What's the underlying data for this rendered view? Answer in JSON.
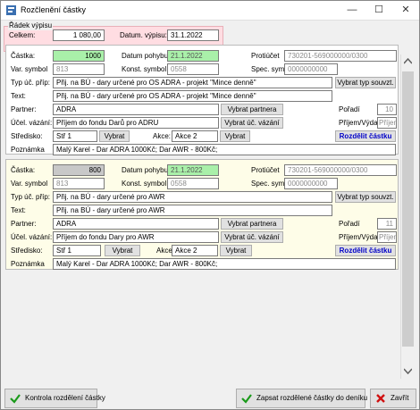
{
  "window": {
    "title": "Rozčlenění částky",
    "minimize": "—",
    "maximize": "☐",
    "close": "✕"
  },
  "statement": {
    "group_label": "Řádek výpisu",
    "total_label": "Celkem:",
    "total_value": "1 080,00",
    "date_label": "Datum. výpisu:",
    "date_value": "31.1.2022"
  },
  "labels": {
    "castka": "Částka:",
    "datum_pohybu": "Datum pohybu:",
    "protiucet": "Protiúčet",
    "var_symbol": "Var. symbol",
    "konst_symbol": "Konst. symbol",
    "spec_sym": "Spec. sym:",
    "typ_uc_prip": "Typ úč. příp:",
    "text": "Text:",
    "partner": "Partner:",
    "ucet_vazani": "Účel. vázání:",
    "poradi": "Pořadí",
    "prijem_vydaj": "Příjem/Výdaj",
    "stredisko": "Středisko:",
    "akce": "Akce:",
    "poznamka": "Poznámka"
  },
  "buttons": {
    "vybrat_typ": "Vybrat typ souvzt.",
    "vybrat_partnera": "Vybrat partnera",
    "vybrat_uc": "Vybrat úč. vázání",
    "vybrat": "Vybrat",
    "rozdelit": "Rozdělit částku"
  },
  "split1": {
    "castka": "1000",
    "datum": "21.1.2022",
    "protiucet": "730201-569000000/0300",
    "var_symbol": "813",
    "konst_symbol": "0558",
    "spec_sym": "0000000000",
    "typ": "Přij. na BÚ - dary určené pro OS ADRA - projekt \"Mince denně\"",
    "text": "Přij. na BÚ - dary určené pro OS ADRA - projekt \"Mince denně\"",
    "partner": "ADRA",
    "ucet": "Příjem do fondu Darů pro ADRU",
    "poradi": "10",
    "prijem": "Příjem",
    "stredisko": "Stř 1",
    "akce": "Akce 2",
    "poznamka": "Malý Karel - Dar ADRA 1000Kč; Dar AWR - 800Kč;"
  },
  "split2": {
    "castka": "800",
    "datum": "21.1.2022",
    "protiucet": "730201-569000000/0300",
    "var_symbol": "813",
    "konst_symbol": "0558",
    "spec_sym": "0000000000",
    "typ": "Přij. na BÚ - dary určené pro AWR",
    "text": "Přij. na BÚ - dary určené pro AWR",
    "partner": "ADRA",
    "ucet": "Příjem do fondu Dary pro AWR",
    "poradi": "11",
    "prijem": "Příjem",
    "stredisko": "Stř 1",
    "akce": "Akce 2",
    "poznamka": "Malý Karel - Dar ADRA 1000Kč; Dar AWR - 800Kč;"
  },
  "footer": {
    "kontrola": "Kontrola rozdělení částky",
    "zapsat": "Zapsat rozdělené částky do deníku",
    "zavrit": "Zavřít"
  },
  "colors": {
    "green": "#a9f0a9",
    "link_blue": "#0000c8"
  }
}
